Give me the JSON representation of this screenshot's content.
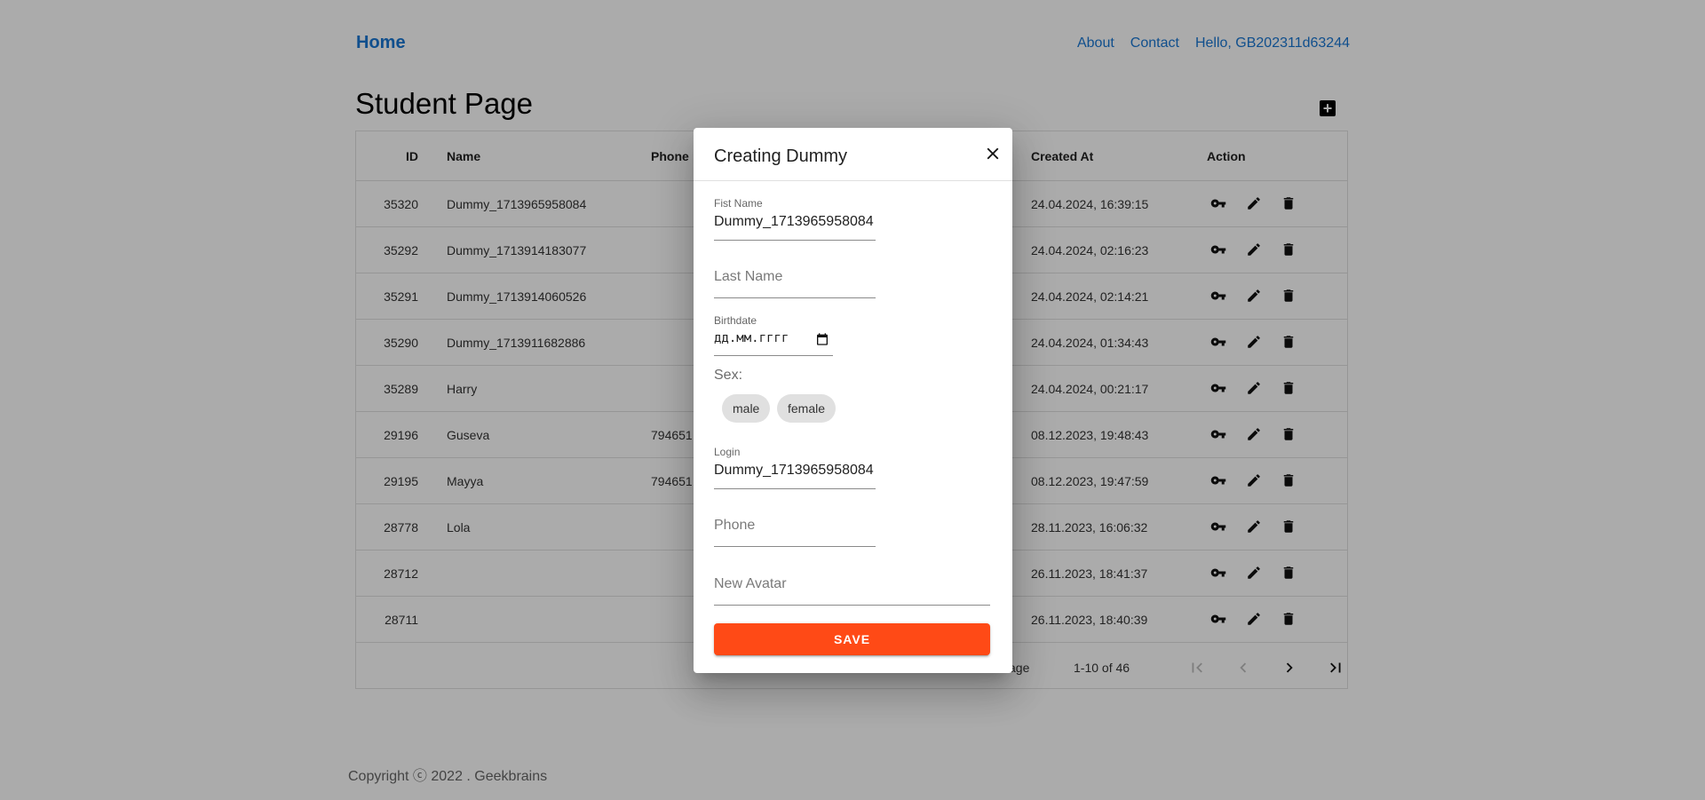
{
  "nav": {
    "home": "Home",
    "about": "About",
    "contact": "Contact",
    "greeting": "Hello, GB202311d63244"
  },
  "page": {
    "title": "Student Page",
    "add_icon": "plus-square-icon"
  },
  "table": {
    "headers": {
      "id": "ID",
      "name": "Name",
      "phone": "Phone",
      "created": "Created At",
      "action": "Action"
    },
    "rows": [
      {
        "id": "35320",
        "name": "Dummy_1713965958084",
        "phone": "",
        "created": "24.04.2024, 16:39:15"
      },
      {
        "id": "35292",
        "name": "Dummy_1713914183077",
        "phone": "",
        "created": "24.04.2024, 02:16:23"
      },
      {
        "id": "35291",
        "name": "Dummy_1713914060526",
        "phone": "",
        "created": "24.04.2024, 02:14:21"
      },
      {
        "id": "35290",
        "name": "Dummy_1713911682886",
        "phone": "",
        "created": "24.04.2024, 01:34:43"
      },
      {
        "id": "35289",
        "name": "Harry",
        "phone": "",
        "created": "24.04.2024, 00:21:17"
      },
      {
        "id": "29196",
        "name": "Guseva",
        "phone": "794651",
        "created": "08.12.2023, 19:48:43"
      },
      {
        "id": "29195",
        "name": "Mayya",
        "phone": "794651",
        "created": "08.12.2023, 19:47:59"
      },
      {
        "id": "28778",
        "name": "Lola",
        "phone": "",
        "created": "28.11.2023, 16:06:32"
      },
      {
        "id": "28712",
        "name": "",
        "phone": "",
        "created": "26.11.2023, 18:41:37"
      },
      {
        "id": "28711",
        "name": "",
        "phone": "",
        "created": "26.11.2023, 18:40:39"
      }
    ],
    "action_icons": [
      "key-icon",
      "edit-icon",
      "delete-icon"
    ]
  },
  "pagination": {
    "rows_per_page_label": "age",
    "range": "1-10 of 46"
  },
  "footer": {
    "copyright": "Copyright ⓒ 2022 . Geekbrains"
  },
  "modal": {
    "title": "Creating Dummy",
    "first_name": {
      "label": "Fist Name",
      "value": "Dummy_1713965958084"
    },
    "last_name": {
      "placeholder": "Last Name"
    },
    "birthdate": {
      "label": "Birthdate",
      "value": "дд.мм.гггг"
    },
    "sex": {
      "label": "Sex:",
      "options": [
        "male",
        "female"
      ]
    },
    "login": {
      "label": "Login",
      "value": "Dummy_1713965958084"
    },
    "phone": {
      "placeholder": "Phone"
    },
    "avatar": {
      "placeholder": "New Avatar"
    },
    "save_label": "SAVE"
  },
  "colors": {
    "link": "#1976d2",
    "save_button": "#ff4a16",
    "overlay": "rgba(0,0,0,0.33)"
  }
}
